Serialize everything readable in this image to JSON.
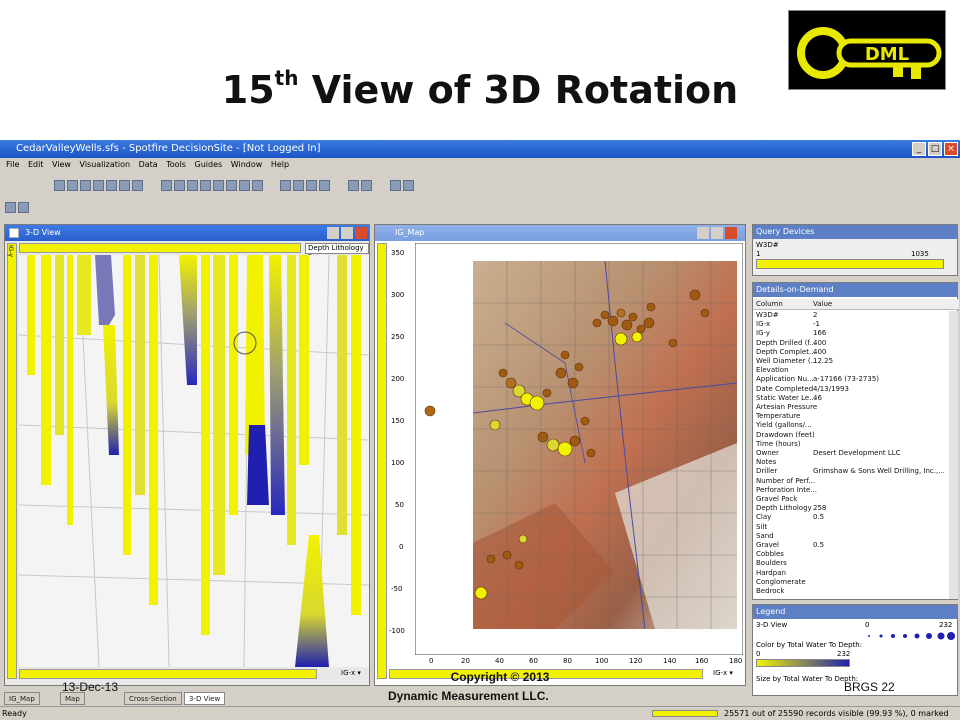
{
  "slide": {
    "title_main": "15",
    "title_sup": "th",
    "title_rest": " View of 3D Rotation",
    "logo_text": "DML",
    "date": "13-Dec-13",
    "copyright_line1": "Copyright © 2013",
    "copyright_line2": "Dynamic Measurement LLC.",
    "footer_right": "BRGS  22"
  },
  "app": {
    "window_title": "CedarValleyWells.sfs - Spotfire DecisionSite - [Not Logged In]",
    "menu": [
      "File",
      "Edit",
      "View",
      "Visualization",
      "Data",
      "Tools",
      "Guides",
      "Window",
      "Help"
    ],
    "status_left": "Ready",
    "status_right": "25571 out of 25590 records visible (99.93 %), 0 marked",
    "tabs": [
      "IG_Map",
      "Map",
      "Cross-Section",
      "3-D View"
    ]
  },
  "view3d": {
    "title": "3-D View",
    "axis_left": "IG-y",
    "dropdown": "Depth Lithology",
    "bottom_axis": "IG-x"
  },
  "igmap": {
    "title": "IG_Map",
    "axis_left": "IG-y",
    "bottom_axis": "IG-x",
    "y_ticks": [
      "350",
      "300",
      "250",
      "200",
      "150",
      "100",
      "50",
      "0",
      "-50",
      "-100"
    ],
    "x_ticks": [
      "0",
      "20",
      "40",
      "60",
      "80",
      "100",
      "120",
      "140",
      "160",
      "180"
    ]
  },
  "query": {
    "title": "Query Devices",
    "field": "W3D#",
    "min": "1",
    "max": "1035"
  },
  "dod": {
    "title": "Details-on-Demand",
    "col_header": "Column",
    "val_header": "Value",
    "rows": [
      [
        "W3D#",
        "2"
      ],
      [
        "IG-x",
        "-1"
      ],
      [
        "IG-y",
        "166"
      ],
      [
        "Depth Drilled (f...",
        "400"
      ],
      [
        "Depth Complet...",
        "400"
      ],
      [
        "Well Diameter (...",
        "12.25"
      ],
      [
        "Elevation",
        ""
      ],
      [
        "Application Nu...",
        "a-17166 (73-2735)"
      ],
      [
        "Date Completed",
        "4/13/1993"
      ],
      [
        "Static Water Le...",
        "46"
      ],
      [
        "Artesian Pressure",
        ""
      ],
      [
        "Temperature",
        ""
      ],
      [
        "Yield (gallons/...",
        ""
      ],
      [
        "Drawdown (feet)",
        ""
      ],
      [
        "Time (hours)",
        ""
      ],
      [
        "Owner",
        "Desert Development LLC"
      ],
      [
        "Notes",
        ""
      ],
      [
        "Driller",
        "Grimshaw & Sons Well Drilling, Inc.,..."
      ],
      [
        "Number of Perf...",
        ""
      ],
      [
        "Perforation Inte...",
        ""
      ],
      [
        "Gravel Pack",
        ""
      ],
      [
        "Depth Lithology",
        "258"
      ],
      [
        "Clay",
        "0.5"
      ],
      [
        "Silt",
        ""
      ],
      [
        "Sand",
        ""
      ],
      [
        "Gravel",
        "0.5"
      ],
      [
        "Cobbles",
        ""
      ],
      [
        "Boulders",
        ""
      ],
      [
        "Hardpan",
        ""
      ],
      [
        "Conglomerate",
        ""
      ],
      [
        "Bedrock",
        ""
      ]
    ]
  },
  "legend": {
    "title": "Legend",
    "view": "3-D View",
    "scale_min": "0",
    "scale_max": "232",
    "color_label": "Color by Total Water To Depth:",
    "color_min": "0",
    "color_max": "232",
    "size_label": "Size by Total Water To Depth:"
  },
  "colors": {
    "accent": "#2a5fcc",
    "bar_yellow": "#f2f200",
    "bar_blue": "#2020b0",
    "map_point": "#a05a12"
  }
}
